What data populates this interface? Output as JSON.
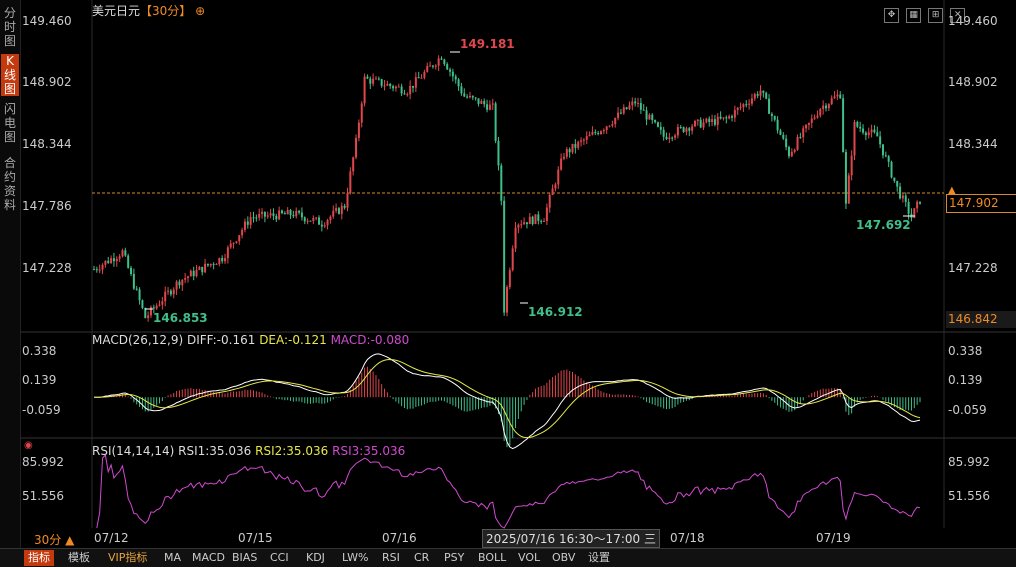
{
  "sidebar": {
    "tabs": [
      {
        "label": "分时图",
        "active": false
      },
      {
        "label": "K线图",
        "active": true
      },
      {
        "label": "闪电图",
        "active": false
      },
      {
        "label": "合约资料",
        "active": false
      }
    ]
  },
  "header": {
    "instrument": "美元日元",
    "period": "【30分】"
  },
  "price_axis": {
    "labels": [
      "149.460",
      "148.902",
      "148.344",
      "147.786",
      "147.228"
    ],
    "current_price": "147.902",
    "low_bound": "146.842"
  },
  "annotations": {
    "high": "149.181",
    "low_left": "146.853",
    "low_mid": "146.912",
    "low_right": "147.692"
  },
  "macd": {
    "header_name": "MACD(26,12,9)",
    "diff": "DIFF:-0.161",
    "dea": "DEA:-0.121",
    "macd": "MACD:-0.080",
    "axis": [
      "0.338",
      "0.139",
      "-0.059"
    ]
  },
  "rsi": {
    "header_name": "RSI(14,14,14)",
    "rsi1": "RSI1:35.036",
    "rsi2": "RSI2:35.036",
    "rsi3": "RSI3:35.036",
    "axis": [
      "85.992",
      "51.556"
    ]
  },
  "date_axis": {
    "period_label": "30分 ▲",
    "dates": [
      "07/12",
      "07/15",
      "07/16",
      "07/18",
      "07/19"
    ],
    "cursor_label": "2025/07/16 16:30～17:00 三"
  },
  "bottom_tabs": [
    "指标",
    "模板",
    "VIP指标",
    "MA",
    "MACD",
    "BIAS",
    "CCI",
    "KDJ",
    "LW%",
    "RSI",
    "CR",
    "PSY",
    "BOLL",
    "VOL",
    "OBV",
    "设置"
  ],
  "colors": {
    "up": "#e0474c",
    "down": "#3fbf8a",
    "diff_line": "#ffffff",
    "dea_line": "#e8e84a",
    "rsi_line": "#d04ad0",
    "accent": "#f08a24"
  },
  "chart_data": {
    "type": "candlestick",
    "title": "美元日元",
    "price_ylim": [
      146.842,
      149.46
    ],
    "series_close_samples": [
      {
        "label": "07/12",
        "close": 147.35
      },
      {
        "label": "07/12",
        "close": 146.853
      },
      {
        "label": "07/15",
        "close": 147.75
      },
      {
        "label": "07/16",
        "close": 148.95
      },
      {
        "label": "07/16",
        "close": 149.181
      },
      {
        "label": "07/16",
        "close": 146.912
      },
      {
        "label": "07/18",
        "close": 148.6
      },
      {
        "label": "07/19",
        "close": 148.8
      },
      {
        "label": "07/19",
        "close": 147.692
      },
      {
        "label": "07/19",
        "close": 147.902
      }
    ]
  }
}
